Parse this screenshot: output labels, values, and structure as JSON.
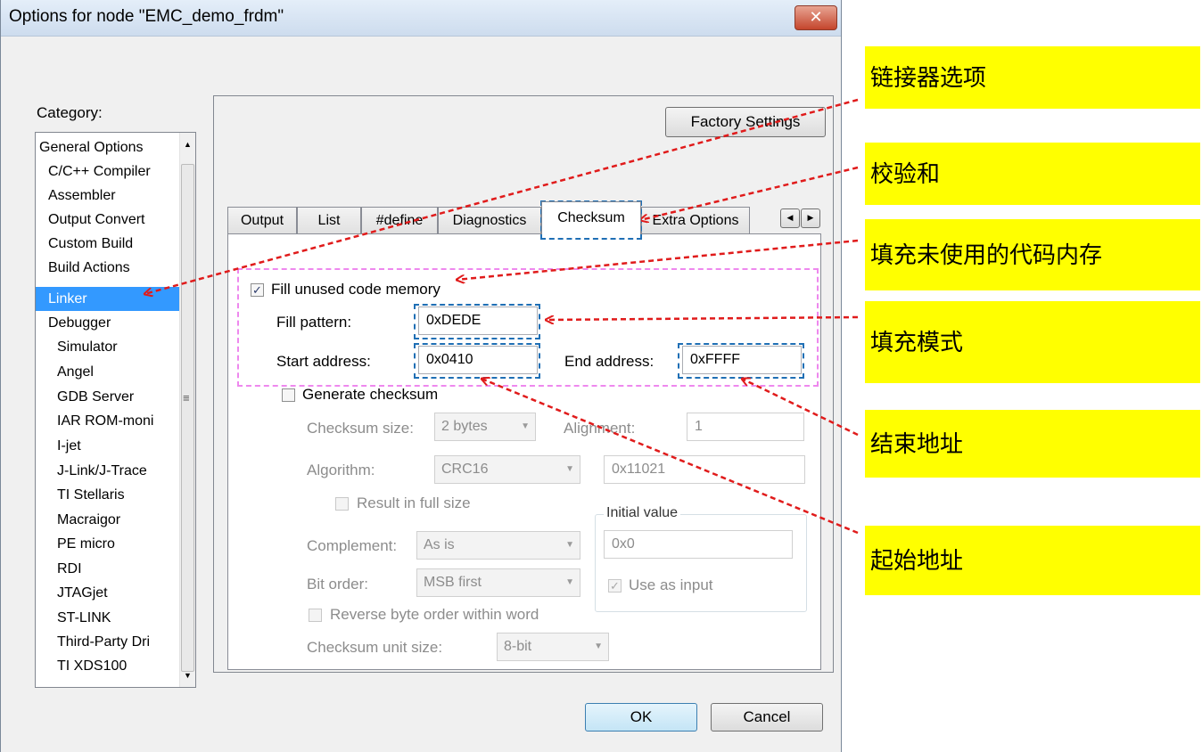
{
  "window": {
    "title": "Options for node \"EMC_demo_frdm\"",
    "close_glyph": "✕"
  },
  "category": {
    "label": "Category:",
    "items": [
      "General Options",
      "C/C++ Compiler",
      "Assembler",
      "Output Convert",
      "Custom Build",
      "Build Actions",
      "Linker",
      "Debugger",
      "Simulator",
      "Angel",
      "GDB Server",
      "IAR ROM-moni",
      "I-jet",
      "J-Link/J-Trace",
      "TI Stellaris",
      "Macraigor",
      "PE micro",
      "RDI",
      "JTAGjet",
      "ST-LINK",
      "Third-Party Dri",
      "TI XDS100"
    ],
    "selected": "Linker",
    "scroll_marker": "≡"
  },
  "factory_settings_label": "Factory Settings",
  "tabs": [
    "Output",
    "List",
    "#define",
    "Diagnostics",
    "Checksum",
    "Extra Options"
  ],
  "active_tab": "Checksum",
  "checksum": {
    "fill_unused_label": "Fill unused code memory",
    "fill_unused_checked": true,
    "fill_pattern_label": "Fill pattern:",
    "fill_pattern_value": "0xDEDE",
    "start_address_label": "Start address:",
    "start_address_value": "0x0410",
    "end_address_label": "End address:",
    "end_address_value": "0xFFFF",
    "generate_checksum_label": "Generate checksum",
    "checksum_size_label": "Checksum size:",
    "checksum_size_value": "2 bytes",
    "alignment_label": "Alignment:",
    "alignment_value": "1",
    "algorithm_label": "Algorithm:",
    "algorithm_value": "CRC16",
    "polynomial_value": "0x11021",
    "result_full_size_label": "Result in full size",
    "initial_value_group": "Initial value",
    "initial_value": "0x0",
    "complement_label": "Complement:",
    "complement_value": "As is",
    "bit_order_label": "Bit order:",
    "bit_order_value": "MSB first",
    "use_as_input_label": "Use as input",
    "reverse_byte_label": "Reverse byte order within word",
    "unit_size_label": "Checksum unit size:",
    "unit_size_value": "8-bit"
  },
  "buttons": {
    "ok": "OK",
    "cancel": "Cancel"
  },
  "callouts": [
    "链接器选项",
    "校验和",
    "填充未使用的代码内存",
    "填充模式",
    "结束地址",
    "起始地址"
  ],
  "colors": {
    "callout_bg": "#ffff00",
    "arrow": "#e01b1b",
    "highlight_box": "#1f6fb5",
    "group_box": "#ee88ee",
    "selection": "#3399ff"
  },
  "icons": [
    "close-icon",
    "scroll-up-icon",
    "scroll-down-icon",
    "tab-scroll-left-icon",
    "tab-scroll-right-icon",
    "check-icon",
    "dropdown-arrow-icon"
  ]
}
